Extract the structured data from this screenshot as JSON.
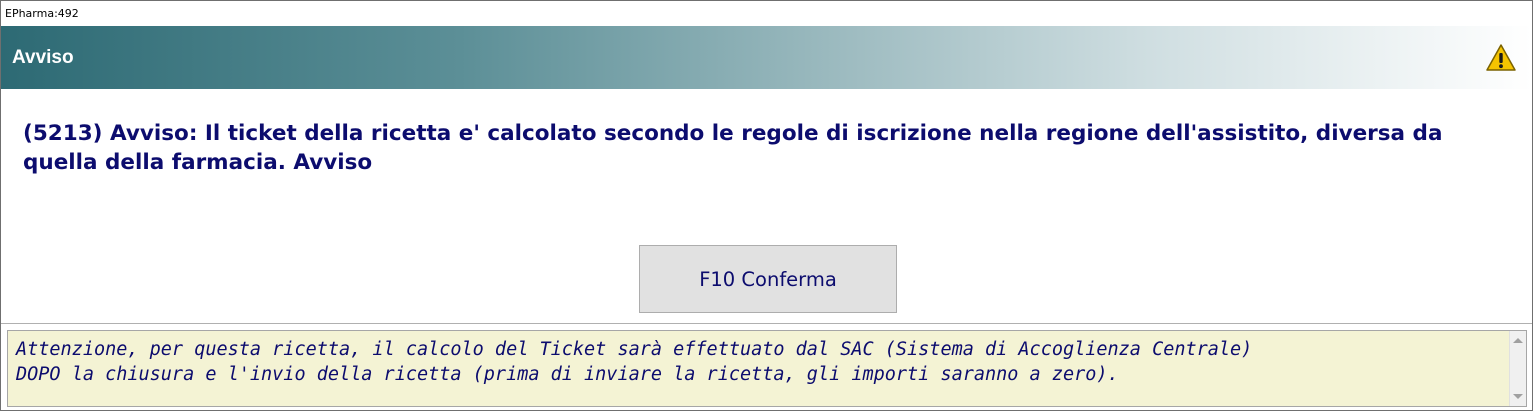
{
  "window": {
    "title": "EPharma:492"
  },
  "header": {
    "title": "Avviso",
    "icon": "warning-icon"
  },
  "message": {
    "text": "(5213) Avviso: Il ticket della ricetta e' calcolato secondo le regole di iscrizione nella regione dell'assistito, diversa da quella della farmacia. Avviso"
  },
  "actions": {
    "confirm_label": "F10 Conferma"
  },
  "note": {
    "text": "Attenzione, per questa ricetta, il calcolo del Ticket sarà effettuato dal SAC (Sistema di Accoglienza Centrale)\nDOPO la chiusura e l'invio della ricetta (prima di inviare la ricetta, gli importi saranno a zero)."
  },
  "colors": {
    "header_gradient_start": "#2d6a74",
    "message_text": "#0c0c6e",
    "note_background": "#f4f3d4",
    "button_background": "#e1e1e1"
  }
}
